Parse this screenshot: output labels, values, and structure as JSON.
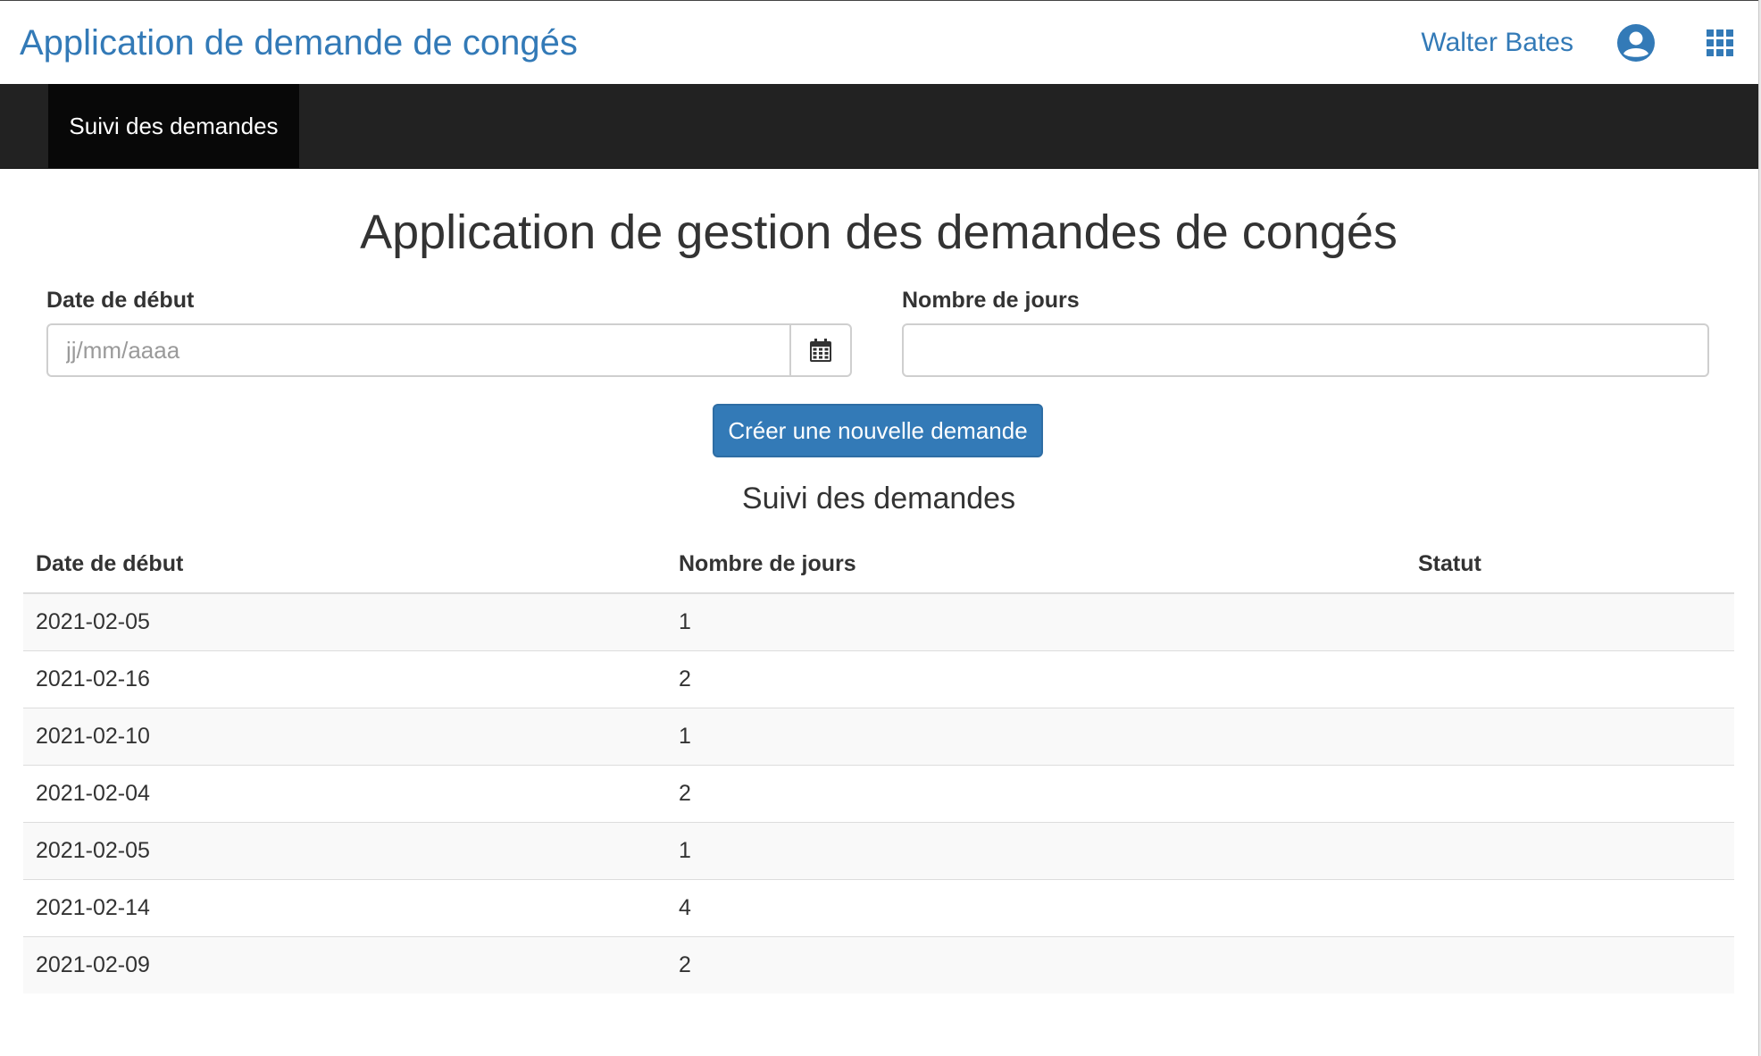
{
  "header": {
    "app_title": "Application de demande de congés",
    "user_name": "Walter Bates",
    "user_icon": "user-circle-icon",
    "apps_icon": "grid-apps-icon"
  },
  "nav": {
    "active_tab": "Suivi des demandes"
  },
  "page": {
    "title": "Application de gestion des demandes de congés"
  },
  "form": {
    "start_date_label": "Date de début",
    "start_date_placeholder": "jj/mm/aaaa",
    "start_date_value": "",
    "calendar_icon": "calendar-icon",
    "days_label": "Nombre de jours",
    "days_value": "",
    "submit_label": "Créer une nouvelle demande"
  },
  "tracking": {
    "title": "Suivi des demandes",
    "columns": [
      "Date de début",
      "Nombre de jours",
      "Statut"
    ],
    "rows": [
      {
        "start": "2021-02-05",
        "days": "1",
        "status": ""
      },
      {
        "start": "2021-02-16",
        "days": "2",
        "status": ""
      },
      {
        "start": "2021-02-10",
        "days": "1",
        "status": ""
      },
      {
        "start": "2021-02-04",
        "days": "2",
        "status": ""
      },
      {
        "start": "2021-02-05",
        "days": "1",
        "status": ""
      },
      {
        "start": "2021-02-14",
        "days": "4",
        "status": ""
      },
      {
        "start": "2021-02-09",
        "days": "2",
        "status": ""
      }
    ]
  },
  "colors": {
    "accent": "#337ab7",
    "navbar": "#222222",
    "nav_active": "#080808"
  }
}
